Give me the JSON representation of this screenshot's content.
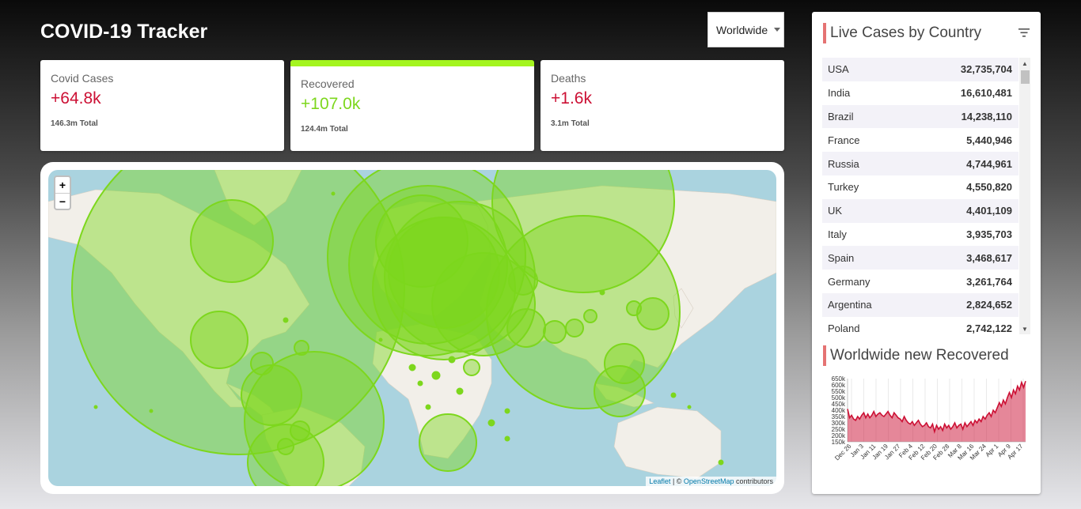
{
  "header": {
    "title": "COVID-19 Tracker"
  },
  "country_select": {
    "value": "Worldwide"
  },
  "cards": [
    {
      "title": "Covid Cases",
      "value": "+64.8k",
      "total": "146.3m Total",
      "color": "#cc1034"
    },
    {
      "title": "Recovered",
      "value": "+107.0k",
      "total": "124.4m Total",
      "color": "#7dd71d"
    },
    {
      "title": "Deaths",
      "value": "+1.6k",
      "total": "3.1m Total",
      "color": "#cc1034"
    }
  ],
  "map": {
    "zoom_in": "+",
    "zoom_out": "−",
    "attribution": {
      "leaflet": "Leaflet",
      "sep": " | © ",
      "osm": "OpenStreetMap",
      "suffix": " contributors"
    },
    "circle_color": "#7dd71d"
  },
  "side": {
    "table_title": "Live Cases by Country",
    "graph_title": "Worldwide new Recovered",
    "countries": [
      {
        "country": "USA",
        "cases": "32,735,704"
      },
      {
        "country": "India",
        "cases": "16,610,481"
      },
      {
        "country": "Brazil",
        "cases": "14,238,110"
      },
      {
        "country": "France",
        "cases": "5,440,946"
      },
      {
        "country": "Russia",
        "cases": "4,744,961"
      },
      {
        "country": "Turkey",
        "cases": "4,550,820"
      },
      {
        "country": "UK",
        "cases": "4,401,109"
      },
      {
        "country": "Italy",
        "cases": "3,935,703"
      },
      {
        "country": "Spain",
        "cases": "3,468,617"
      },
      {
        "country": "Germany",
        "cases": "3,261,764"
      },
      {
        "country": "Argentina",
        "cases": "2,824,652"
      },
      {
        "country": "Poland",
        "cases": "2,742,122"
      }
    ]
  },
  "chart_data": {
    "type": "area",
    "title": "",
    "xlabel": "",
    "ylabel": "",
    "color": "#cc1034",
    "fill": "rgba(204,16,52,0.5)",
    "ylim": [
      150000,
      650000
    ],
    "y_ticks": [
      "650k",
      "600k",
      "550k",
      "500k",
      "450k",
      "400k",
      "350k",
      "300k",
      "250k",
      "200k",
      "150k"
    ],
    "x_ticks": [
      "Dec 26",
      "Jan 3",
      "Jan 11",
      "Jan 19",
      "Jan 27",
      "Feb 4",
      "Feb 12",
      "Feb 20",
      "Feb 28",
      "Mar 8",
      "Mar 16",
      "Mar 24",
      "Apr 1",
      "Apr 9",
      "Apr 17"
    ],
    "values": [
      410000,
      340000,
      360000,
      330000,
      320000,
      350000,
      330000,
      360000,
      380000,
      340000,
      370000,
      340000,
      360000,
      390000,
      350000,
      370000,
      380000,
      360000,
      350000,
      370000,
      390000,
      360000,
      340000,
      380000,
      360000,
      340000,
      330000,
      310000,
      350000,
      320000,
      300000,
      290000,
      310000,
      280000,
      300000,
      320000,
      290000,
      270000,
      280000,
      300000,
      270000,
      260000,
      290000,
      230000,
      280000,
      250000,
      270000,
      240000,
      290000,
      260000,
      280000,
      250000,
      270000,
      300000,
      260000,
      280000,
      290000,
      250000,
      300000,
      270000,
      290000,
      310000,
      280000,
      320000,
      300000,
      330000,
      310000,
      350000,
      330000,
      360000,
      380000,
      350000,
      400000,
      380000,
      420000,
      460000,
      430000,
      480000,
      450000,
      500000,
      540000,
      500000,
      560000,
      530000,
      590000,
      560000,
      620000,
      580000,
      630000
    ]
  }
}
